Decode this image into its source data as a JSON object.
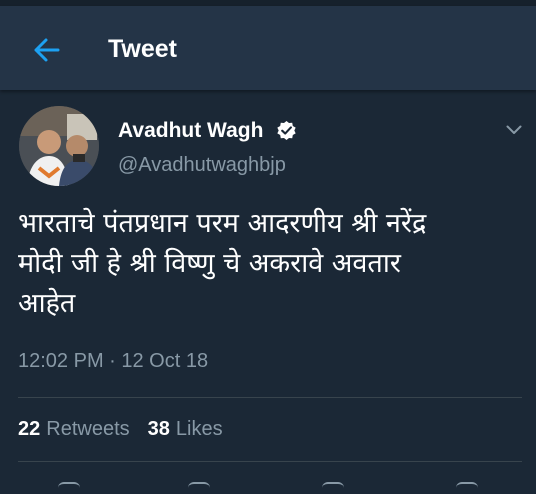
{
  "header": {
    "title": "Tweet",
    "back_icon": "arrow-left-icon",
    "accent_color": "#1da1f2"
  },
  "tweet": {
    "author": {
      "name": "Avadhut Wagh",
      "handle": "@Avadhutwaghbjp",
      "verified": true
    },
    "text": "भारताचे पंतप्रधान परम आदरणीय श्री नरेंद्र\nमोदी जी हे श्री विष्णु चे अकरावे अवतार\nआहेत",
    "timestamp": "12:02 PM · 12 Oct 18",
    "retweets_count": "22",
    "retweets_label": "Retweets",
    "likes_count": "38",
    "likes_label": "Likes"
  },
  "colors": {
    "background": "#1b2836",
    "app_bar": "#243447",
    "secondary_text": "#8899a6",
    "divider": "#38444d"
  },
  "action_icons": [
    "reply-icon",
    "retweet-icon",
    "like-icon",
    "share-icon"
  ]
}
